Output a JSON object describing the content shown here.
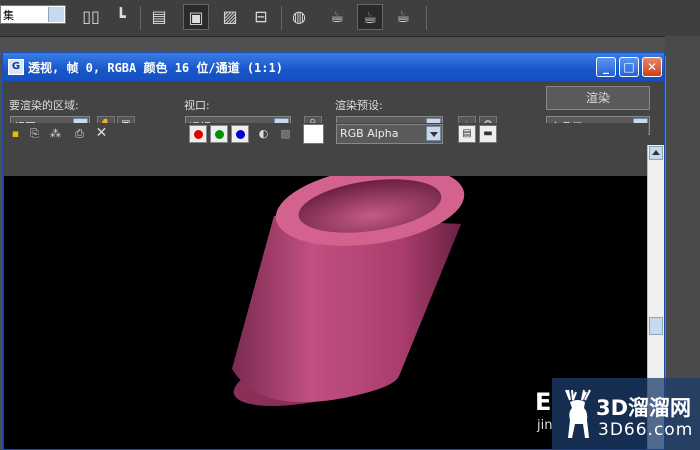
{
  "app_toolbar": {
    "selection_combo": "集"
  },
  "window": {
    "title": "透视, 帧 0, RGBA 颜色 16 位/通道 (1:1)",
    "minimize_glyph": "_",
    "maximize_glyph": "□",
    "close_glyph": "✕"
  },
  "panel": {
    "area_label": "要渲染的区域:",
    "area_value": "视图",
    "viewport_label": "视口:",
    "viewport_value": "透视",
    "preset_label": "渲染预设:",
    "preset_value": "-------------------",
    "render_button": "渲染",
    "quality_value": "产品级"
  },
  "channel_toolbar": {
    "channel_value": "RGB Alpha",
    "red_color": "#e00000",
    "green_color": "#009000",
    "blue_color": "#0000d0"
  },
  "render": {
    "object_color": "#c04a7a"
  },
  "watermark": {
    "big": "3D溜溜网",
    "small": "3D66.com",
    "left_big": "E",
    "left_small": "jin"
  }
}
